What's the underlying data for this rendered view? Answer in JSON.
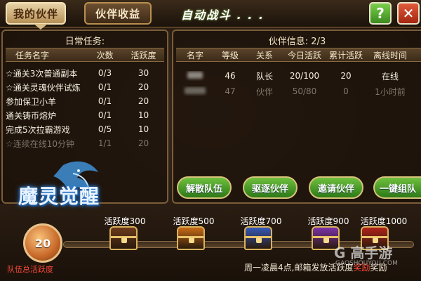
{
  "tabs": [
    {
      "label": "我的伙伴",
      "active": true
    },
    {
      "label": "伙伴收益",
      "active": false
    }
  ],
  "auto_battle_label": "自动战斗 . . .",
  "help_label": "?",
  "close_label": "✕",
  "daily_tasks": {
    "title": "日常任务:",
    "columns": [
      "任务名字",
      "次数",
      "活跃度"
    ],
    "rows": [
      {
        "name": "☆通关3次普通副本",
        "count": "0/3",
        "activity": "30",
        "dim": false
      },
      {
        "name": "☆通关灵魂伙伴试炼",
        "count": "0/1",
        "activity": "20",
        "dim": false
      },
      {
        "name": "参加保卫小羊",
        "count": "0/1",
        "activity": "20",
        "dim": false
      },
      {
        "name": "通关铸币熔炉",
        "count": "0/1",
        "activity": "10",
        "dim": false
      },
      {
        "name": "完成5次拉霸游戏",
        "count": "0/5",
        "activity": "10",
        "dim": false
      },
      {
        "name": "☆连续在线10分钟",
        "count": "1/1",
        "activity": "20",
        "dim": true
      }
    ]
  },
  "partner_info": {
    "title": "伙伴信息:  2/3",
    "columns": [
      "名字",
      "等级",
      "关系",
      "今日活跃",
      "累计活跃",
      "离线时间"
    ],
    "rows": [
      {
        "level": "46",
        "relation": "队长",
        "today": "20/100",
        "total": "20",
        "offline": "在线",
        "dim": false
      },
      {
        "level": "47",
        "relation": "伙伴",
        "today": "50/80",
        "total": "0",
        "offline": "1小时前",
        "dim": true
      }
    ]
  },
  "actions": [
    "解散队伍",
    "驱逐伙伴",
    "邀请伙伴",
    "一键组队"
  ],
  "logo_text": "魔灵觉醒",
  "progress": {
    "current": "20",
    "team_label": "队伍总活跃度",
    "fill_fraction": 0.0,
    "milestones": [
      {
        "label": "活跃度300",
        "chest_color": "#6b3a1c"
      },
      {
        "label": "活跃度500",
        "chest_color": "#c66a16"
      },
      {
        "label": "活跃度700",
        "chest_color": "#3457b8"
      },
      {
        "label": "活跃度900",
        "chest_color": "#7a32a8"
      },
      {
        "label": "活跃度1000",
        "chest_color": "#b0221a"
      }
    ]
  },
  "weekly_note_prefix": "周一凌晨4点,邮箱发放活跃度",
  "weekly_note_red": "奖励",
  "weekly_note_suffix": "奖励",
  "watermark": "G 高手游",
  "watermark_sub": "GAOSHOUYOU.COM"
}
